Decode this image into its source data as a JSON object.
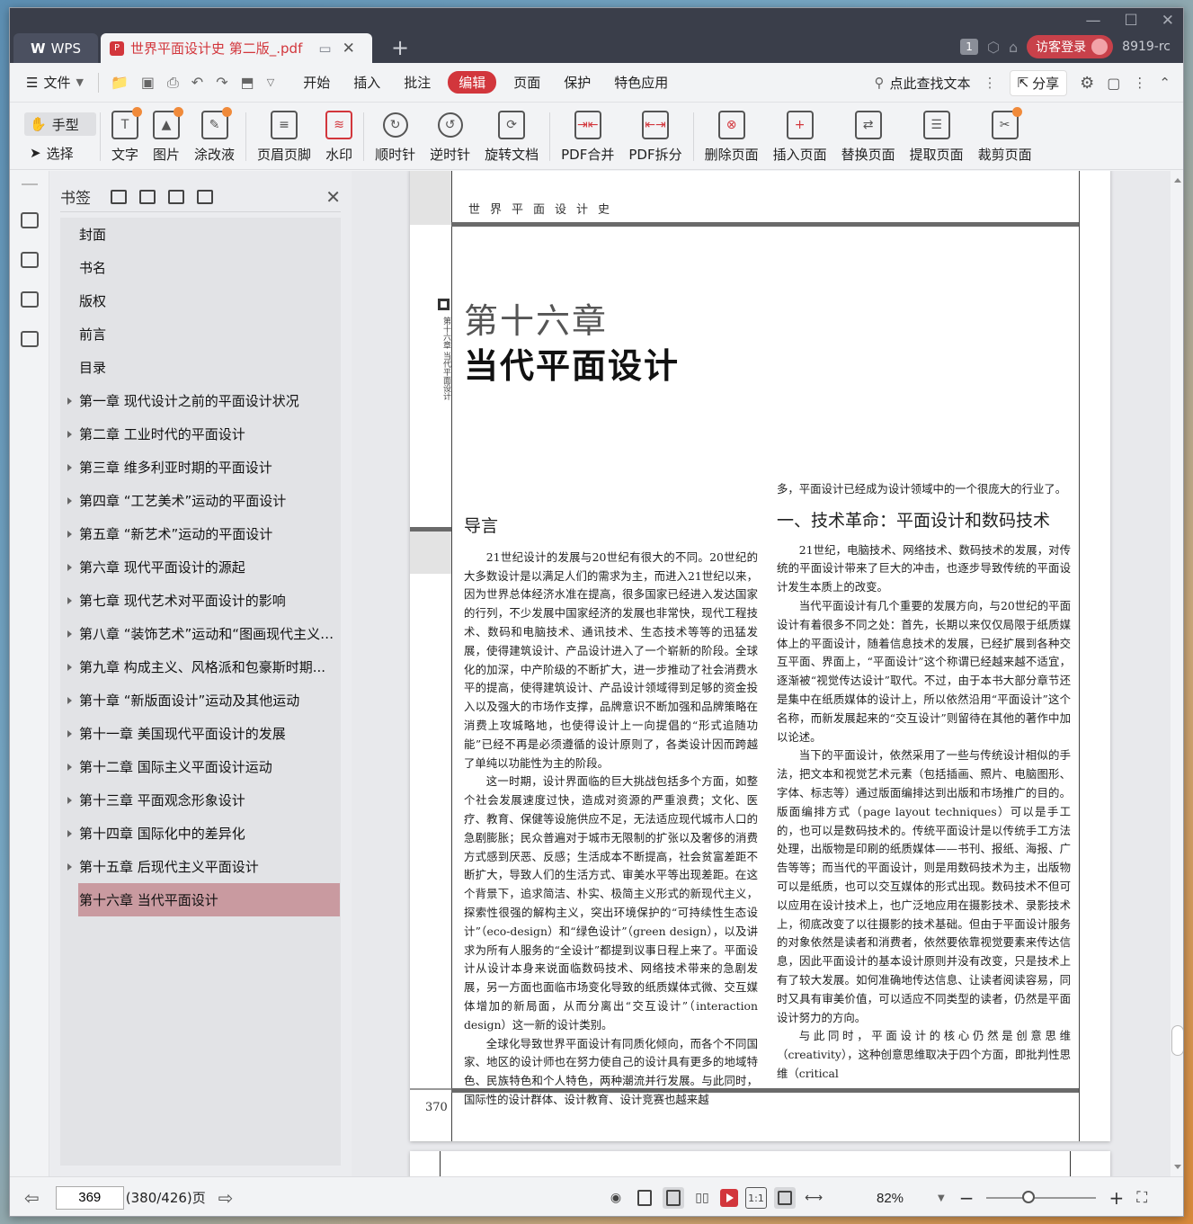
{
  "titlebar": {
    "app_name": "WPS",
    "doc_tab": "世界平面设计史 第二版_.pdf",
    "pdf_icon": "P",
    "new_tab": "+",
    "window_count": "1",
    "login": "访客登录",
    "user_id": "8919-rc",
    "win_minimize": "—",
    "win_maximize": "☐",
    "win_close": "✕",
    "tab_close": "✕"
  },
  "menubar": {
    "file": "文件",
    "items": [
      "开始",
      "插入",
      "批注",
      "编辑",
      "页面",
      "保护",
      "特色应用"
    ],
    "active": "编辑",
    "search": "点此查找文本",
    "share": "分享"
  },
  "toolbar": {
    "hand": "手型",
    "select": "选择",
    "tools": [
      "文字",
      "图片",
      "涂改液",
      "页眉页脚",
      "水印",
      "顺时针",
      "逆时针",
      "旋转文档",
      "PDF合并",
      "PDF拆分",
      "删除页面",
      "插入页面",
      "替换页面",
      "提取页面",
      "裁剪页面"
    ]
  },
  "bookmarks": {
    "title": "书签",
    "close": "✕",
    "items": [
      "封面",
      "书名",
      "版权",
      "前言",
      "目录",
      "第一章  现代设计之前的平面设计状况",
      "第二章  工业时代的平面设计",
      "第三章  维多利亚时期的平面设计",
      "第四章 “工艺美术”运动的平面设计",
      "第五章 “新艺术”运动的平面设计",
      "第六章  现代平面设计的源起",
      "第七章  现代艺术对平面设计的影响",
      "第八章 “装饰艺术”运动和“图画现代主义”...",
      "第九章  构成主义、风格派和包豪斯时期...",
      "第十章 “新版面设计”运动及其他运动",
      "第十一章  美国现代平面设计的发展",
      "第十二章  国际主义平面设计运动",
      "第十三章  平面观念形象设计",
      "第十四章  国际化中的差异化",
      "第十五章  后现代主义平面设计",
      "第十六章  当代平面设计"
    ],
    "selected_index": 20
  },
  "page": {
    "running_head": "世界平面设计史",
    "side_text": "第十六章 当代平面设计",
    "chapter_no": "第十六章",
    "chapter_title": "当代平面设计",
    "intro_heading": "导言",
    "left_paragraphs": [
      "21世纪设计的发展与20世纪有很大的不同。20世纪的大多数设计是以满足人们的需求为主，而进入21世纪以来，因为世界总体经济水准在提高，很多国家已经进入发达国家的行列，不少发展中国家经济的发展也非常快，现代工程技术、数码和电脑技术、通讯技术、生态技术等等的迅猛发展，使得建筑设计、产品设计进入了一个崭新的阶段。全球化的加深，中产阶级的不断扩大，进一步推动了社会消费水平的提高，使得建筑设计、产品设计领域得到足够的资金投入以及强大的市场作支撑，品牌意识不断加强和品牌策略在消费上攻城略地，也使得设计上一向提倡的“形式追随功能”已经不再是必须遵循的设计原则了，各类设计因而跨越了单纯以功能性为主的阶段。",
      "这一时期，设计界面临的巨大挑战包括多个方面，如整个社会发展速度过快，造成对资源的严重浪费；文化、医疗、教育、保健等设施供应不足，无法适应现代城市人口的急剧膨胀；民众普遍对于城市无限制的扩张以及奢侈的消费方式感到厌恶、反感；生活成本不断提高，社会贫富差距不断扩大，导致人们的生活方式、审美水平等出现差距。在这个背景下，追求简洁、朴实、极简主义形式的新现代主义，探索性很强的解构主义，突出环境保护的“可持续性生态设计”（eco-design）和“绿色设计”（green design），以及讲求为所有人服务的“全设计”都提到议事日程上来了。平面设计从设计本身来说面临数码技术、网络技术带来的急剧发展，另一方面也面临市场变化导致的纸质媒体式微、交互媒体增加的新局面，从而分离出“交互设计”（interaction design）这一新的设计类别。",
      "全球化导致世界平面设计有同质化倾向，而各个不同国家、地区的设计师也在努力使自己的设计具有更多的地域特色、民族特色和个人特色，两种潮流并行发展。与此同时， 国际性的设计群体、设计教育、设计竞赛也越来越"
    ],
    "right_lead": "多，平面设计已经成为设计领域中的一个很庞大的行业了。",
    "section_heading": "一、技术革命：平面设计和数码技术",
    "right_paragraphs": [
      "21世纪，电脑技术、网络技术、数码技术的发展，对传统的平面设计带来了巨大的冲击，也逐步导致传统的平面设计发生本质上的改变。",
      "当代平面设计有几个重要的发展方向，与20世纪的平面设计有着很多不同之处：首先，长期以来仅仅局限于纸质媒体上的平面设计，随着信息技术的发展，已经扩展到各种交互平面、界面上，“平面设计”这个称谓已经越来越不适宜，逐渐被“视觉传达设计”取代。不过，由于本书大部分章节还是集中在纸质媒体的设计上，所以依然沿用“平面设计”这个名称，而新发展起来的“交互设计”则留待在其他的著作中加以论述。",
      "当下的平面设计，依然采用了一些与传统设计相似的手法，把文本和视觉艺术元素（包括插画、照片、电脑图形、字体、标志等）通过版面编排达到出版和市场推广的目的。版面编排方式（page layout techniques）可以是手工的，也可以是数码技术的。传统平面设计是以传统手工方法处理，出版物是印刷的纸质媒体——书刊、报纸、海报、广告等等；而当代的平面设计，则是用数码技术为主，出版物可以是纸质，也可以交互媒体的形式出现。数码技术不但可以应用在设计技术上，也广泛地应用在摄影技术、录影技术上，彻底改变了以往摄影的技术基础。但由于平面设计服务的对象依然是读者和消费者，依然要依靠视觉要素来传达信息，因此平面设计的基本设计原则并没有改变，只是技术上有了较大发展。如何准确地传达信息、让读者阅读容易，同时又具有审美价值，可以适应不同类型的读者，仍然是平面设计努力的方向。",
      "与此同时，平面设计的核心仍然是创意思维（creativity），这种创意思维取决于四个方面，即批判性思维（critical"
    ],
    "page_number": "370"
  },
  "statusbar": {
    "current_page": "369",
    "page_total": "(380/426)页",
    "zoom": "82%",
    "fit_actual": "1:1"
  },
  "icons": {
    "hand": "hand-icon",
    "select": "cursor-icon",
    "search": "search-icon",
    "settings": "gear-icon"
  }
}
